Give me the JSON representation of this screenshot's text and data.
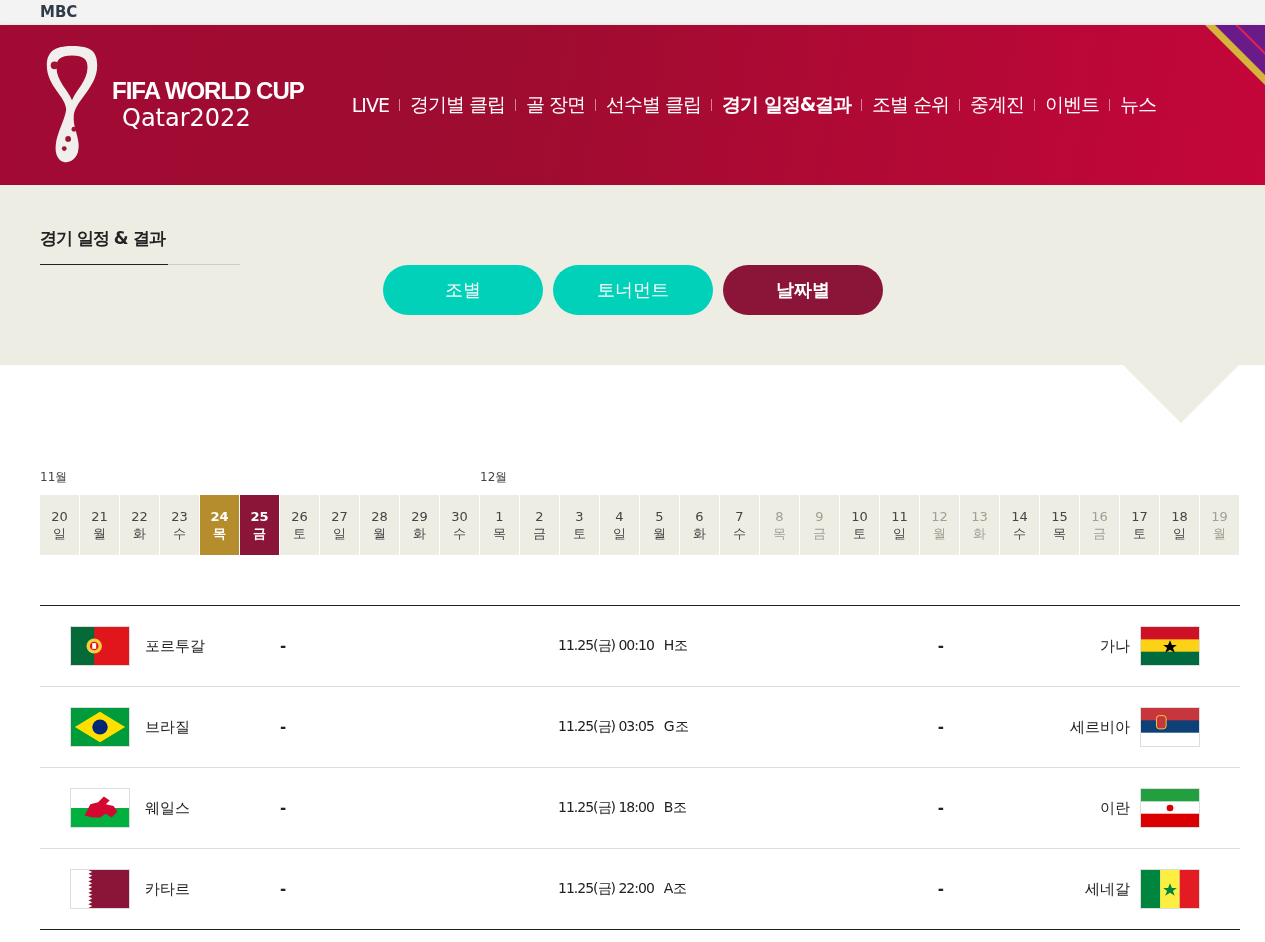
{
  "top_bar": {
    "logo": "MBC"
  },
  "header": {
    "title": "FIFA WORLD CUP",
    "subtitle": "Qatar2022",
    "nav": [
      {
        "label": "LIVE",
        "selected": false
      },
      {
        "label": "경기별 클립",
        "selected": false
      },
      {
        "label": "골 장면",
        "selected": false
      },
      {
        "label": "선수별 클립",
        "selected": false
      },
      {
        "label": "경기 일정&결과",
        "selected": true
      },
      {
        "label": "조별 순위",
        "selected": false
      },
      {
        "label": "중계진",
        "selected": false
      },
      {
        "label": "이벤트",
        "selected": false
      },
      {
        "label": "뉴스",
        "selected": false
      }
    ]
  },
  "section": {
    "title": "경기 일정 & 결과",
    "tabs": [
      {
        "label": "조별",
        "selected": false
      },
      {
        "label": "토너먼트",
        "selected": false
      },
      {
        "label": "날짜별",
        "selected": true
      }
    ]
  },
  "calendar": [
    {
      "month": "11월",
      "day": "20",
      "weekday": "일",
      "today": false,
      "selected": false,
      "disabled": false
    },
    {
      "day": "21",
      "weekday": "월",
      "today": false,
      "selected": false,
      "disabled": false
    },
    {
      "day": "22",
      "weekday": "화",
      "today": false,
      "selected": false,
      "disabled": false
    },
    {
      "day": "23",
      "weekday": "수",
      "today": false,
      "selected": false,
      "disabled": false
    },
    {
      "day": "24",
      "weekday": "목",
      "today": true,
      "selected": false,
      "disabled": false
    },
    {
      "day": "25",
      "weekday": "금",
      "today": false,
      "selected": true,
      "disabled": false
    },
    {
      "day": "26",
      "weekday": "토",
      "today": false,
      "selected": false,
      "disabled": false
    },
    {
      "day": "27",
      "weekday": "일",
      "today": false,
      "selected": false,
      "disabled": false
    },
    {
      "day": "28",
      "weekday": "월",
      "today": false,
      "selected": false,
      "disabled": false
    },
    {
      "day": "29",
      "weekday": "화",
      "today": false,
      "selected": false,
      "disabled": false
    },
    {
      "day": "30",
      "weekday": "수",
      "today": false,
      "selected": false,
      "disabled": false
    },
    {
      "month": "12월",
      "day": "1",
      "weekday": "목",
      "today": false,
      "selected": false,
      "disabled": false
    },
    {
      "day": "2",
      "weekday": "금",
      "today": false,
      "selected": false,
      "disabled": false
    },
    {
      "day": "3",
      "weekday": "토",
      "today": false,
      "selected": false,
      "disabled": false
    },
    {
      "day": "4",
      "weekday": "일",
      "today": false,
      "selected": false,
      "disabled": false
    },
    {
      "day": "5",
      "weekday": "월",
      "today": false,
      "selected": false,
      "disabled": false
    },
    {
      "day": "6",
      "weekday": "화",
      "today": false,
      "selected": false,
      "disabled": false
    },
    {
      "day": "7",
      "weekday": "수",
      "today": false,
      "selected": false,
      "disabled": false
    },
    {
      "day": "8",
      "weekday": "목",
      "today": false,
      "selected": false,
      "disabled": true
    },
    {
      "day": "9",
      "weekday": "금",
      "today": false,
      "selected": false,
      "disabled": true
    },
    {
      "day": "10",
      "weekday": "토",
      "today": false,
      "selected": false,
      "disabled": false
    },
    {
      "day": "11",
      "weekday": "일",
      "today": false,
      "selected": false,
      "disabled": false
    },
    {
      "day": "12",
      "weekday": "월",
      "today": false,
      "selected": false,
      "disabled": true
    },
    {
      "day": "13",
      "weekday": "화",
      "today": false,
      "selected": false,
      "disabled": true
    },
    {
      "day": "14",
      "weekday": "수",
      "today": false,
      "selected": false,
      "disabled": false
    },
    {
      "day": "15",
      "weekday": "목",
      "today": false,
      "selected": false,
      "disabled": false
    },
    {
      "day": "16",
      "weekday": "금",
      "today": false,
      "selected": false,
      "disabled": true
    },
    {
      "day": "17",
      "weekday": "토",
      "today": false,
      "selected": false,
      "disabled": false
    },
    {
      "day": "18",
      "weekday": "일",
      "today": false,
      "selected": false,
      "disabled": false
    },
    {
      "day": "19",
      "weekday": "월",
      "today": false,
      "selected": false,
      "disabled": true
    }
  ],
  "matches": [
    {
      "home": {
        "name": "포르투갈",
        "kind": "portugal"
      },
      "home_score": "-",
      "time": "11.25(금) 00:10",
      "group": "H조",
      "away_score": "-",
      "away": {
        "name": "가나",
        "kind": "ghana"
      }
    },
    {
      "home": {
        "name": "브라질",
        "kind": "brazil"
      },
      "home_score": "-",
      "time": "11.25(금) 03:05",
      "group": "G조",
      "away_score": "-",
      "away": {
        "name": "세르비아",
        "kind": "serbia"
      }
    },
    {
      "home": {
        "name": "웨일스",
        "kind": "wales"
      },
      "home_score": "-",
      "time": "11.25(금) 18:00",
      "group": "B조",
      "away_score": "-",
      "away": {
        "name": "이란",
        "kind": "iran"
      }
    },
    {
      "home": {
        "name": "카타르",
        "kind": "qatar"
      },
      "home_score": "-",
      "time": "11.25(금) 22:00",
      "group": "A조",
      "away_score": "-",
      "away": {
        "name": "세네갈",
        "kind": "senegal"
      }
    }
  ]
}
